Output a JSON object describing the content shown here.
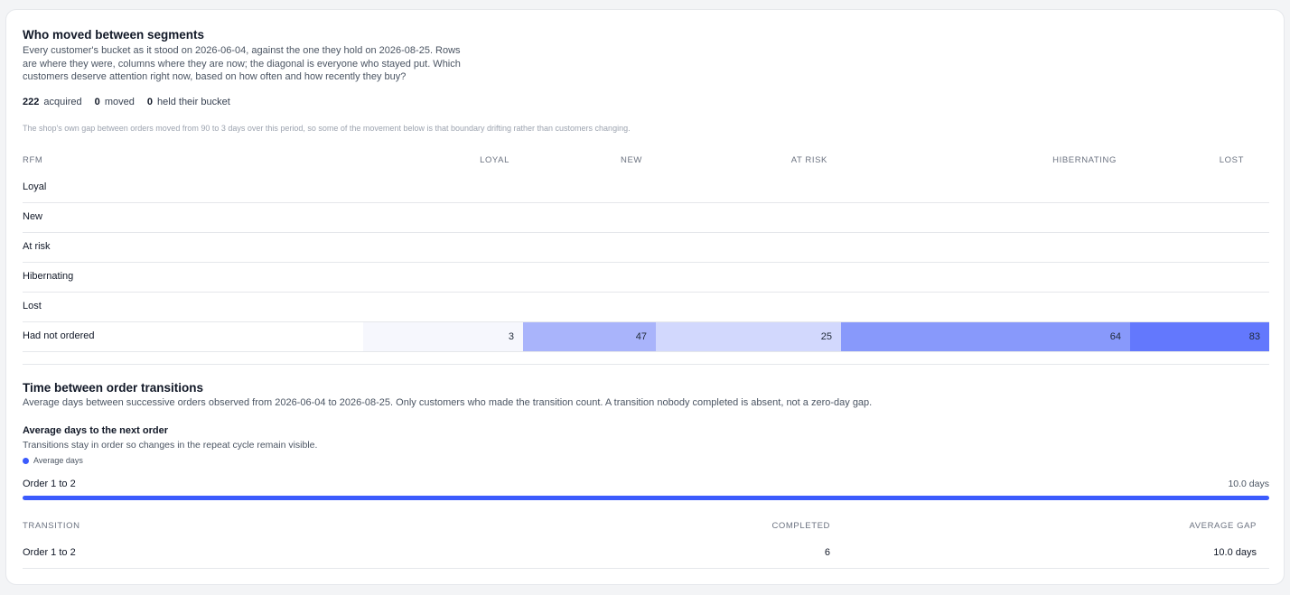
{
  "segments": {
    "title": "Who moved between segments",
    "description": "Every customer's bucket as it stood on 2026-06-04, against the one they hold on 2026-08-25. Rows are where they were, columns where they are now; the diagonal is everyone who stayed put. Which customers deserve attention right now, based on how often and how recently they buy?",
    "stats": [
      {
        "value": "222",
        "label": "acquired"
      },
      {
        "value": "0",
        "label": "moved"
      },
      {
        "value": "0",
        "label": "held their bucket"
      }
    ],
    "note": "The shop's own gap between orders moved from 90 to 3 days over this period, so some of the movement below is that boundary drifting rather than customers changing.",
    "matrix": {
      "corner_label": "RFM",
      "columns": [
        "LOYAL",
        "NEW",
        "AT RISK",
        "HIBERNATING",
        "LOST"
      ],
      "rows": [
        {
          "label": "Loyal",
          "cells": [
            "",
            "",
            "",
            "",
            ""
          ]
        },
        {
          "label": "New",
          "cells": [
            "",
            "",
            "",
            "",
            ""
          ]
        },
        {
          "label": "At risk",
          "cells": [
            "",
            "",
            "",
            "",
            ""
          ]
        },
        {
          "label": "Hibernating",
          "cells": [
            "",
            "",
            "",
            "",
            ""
          ]
        },
        {
          "label": "Lost",
          "cells": [
            "",
            "",
            "",
            "",
            ""
          ]
        },
        {
          "label": "Had not ordered",
          "cells": [
            "3",
            "47",
            "25",
            "64",
            "83"
          ]
        }
      ],
      "cell_colors": [
        "#f6f7fd",
        "#a9b4fb",
        "#d2d8fd",
        "#8899fb",
        "#6378fd"
      ]
    }
  },
  "transitions": {
    "title": "Time between order transitions",
    "description": "Average days between successive orders observed from 2026-06-04 to 2026-08-25. Only customers who made the transition count. A transition nobody completed is absent, not a zero-day gap.",
    "chart_title": "Average days to the next order",
    "chart_subtitle": "Transitions stay in order so changes in the repeat cycle remain visible.",
    "legend_label": "Average days",
    "accent": "#3b5bfd",
    "bars": [
      {
        "label": "Order 1 to 2",
        "value_text": "10.0 days",
        "fraction": 1.0
      }
    ],
    "table": {
      "headers": [
        "TRANSITION",
        "COMPLETED",
        "AVERAGE GAP"
      ],
      "rows": [
        {
          "transition": "Order 1 to 2",
          "completed": "6",
          "average_gap": "10.0 days"
        }
      ]
    }
  }
}
